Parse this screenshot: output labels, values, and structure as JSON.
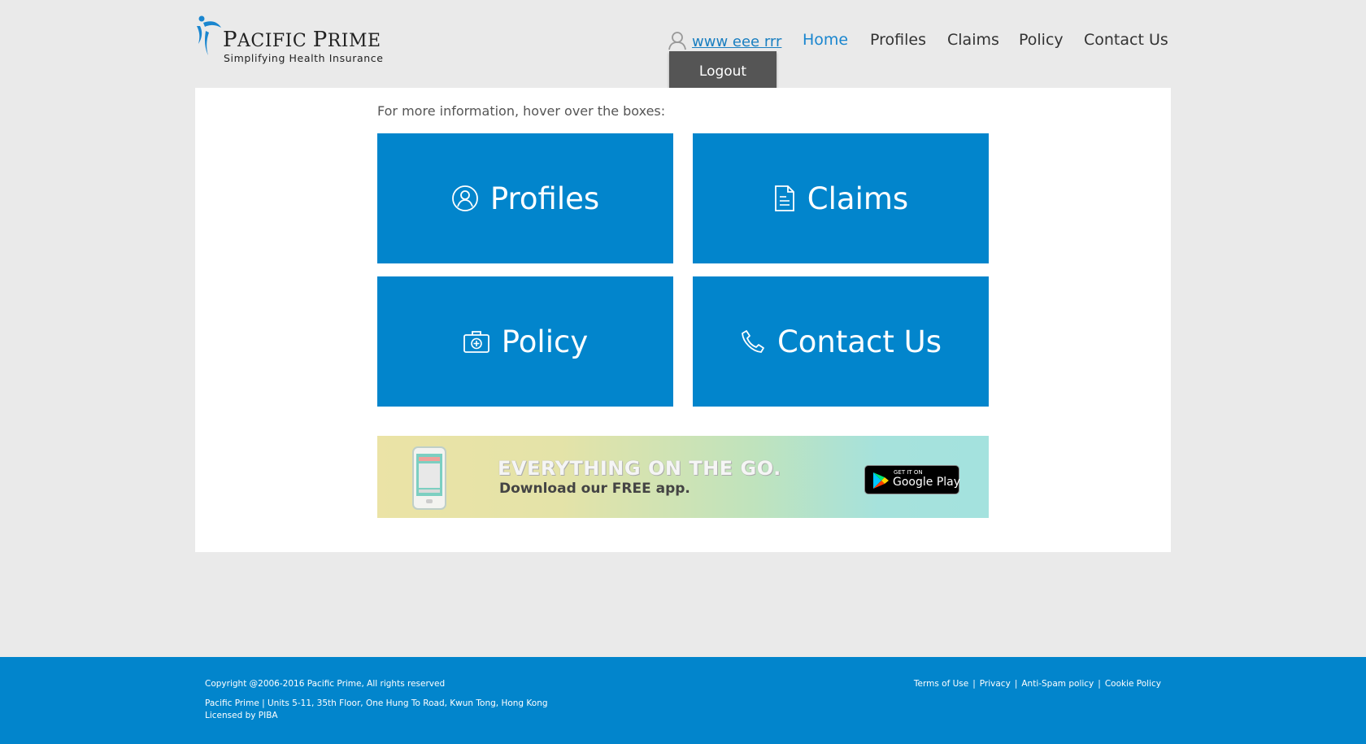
{
  "header": {
    "brand": {
      "cap1": "P",
      "rest1": "ACIFIC ",
      "cap2": "P",
      "rest2": "RIME"
    },
    "tagline": "Simplifying Health Insurance",
    "user_name": "www eee rrr",
    "user_icon": "user-icon",
    "nav": [
      {
        "label": "Home",
        "active": true
      },
      {
        "label": "Profiles",
        "active": false
      },
      {
        "label": "Claims",
        "active": false
      },
      {
        "label": "Policy",
        "active": false
      },
      {
        "label": "Contact Us",
        "active": false
      }
    ],
    "logout_label": "Logout"
  },
  "main": {
    "intro": "For more information, hover over the boxes:",
    "tiles": [
      {
        "label": "Profiles",
        "icon": "profile-icon"
      },
      {
        "label": "Claims",
        "icon": "document-icon"
      },
      {
        "label": "Policy",
        "icon": "medical-kit-icon"
      },
      {
        "label": "Contact Us",
        "icon": "phone-icon"
      }
    ],
    "banner": {
      "headline": "EVERYTHING ON THE GO.",
      "subline": "Download our FREE app.",
      "store_small": "GET IT ON",
      "store_big": "Google Play"
    }
  },
  "footer": {
    "copyright": "Copyright @2006-2016 Pacific Prime, All rights reserved",
    "address": "Pacific Prime | Units 5-11, 35th Floor, One Hung To Road, Kwun Tong, Hong Kong",
    "license": "Licensed by PIBA",
    "links": [
      "Terms of Use",
      "Privacy",
      "Anti-Spam policy",
      "Cookie Policy"
    ]
  },
  "colors": {
    "accent": "#0285cc",
    "nav_active": "#1a86cf",
    "background": "#eaeaea",
    "logout_bg": "#555555"
  }
}
